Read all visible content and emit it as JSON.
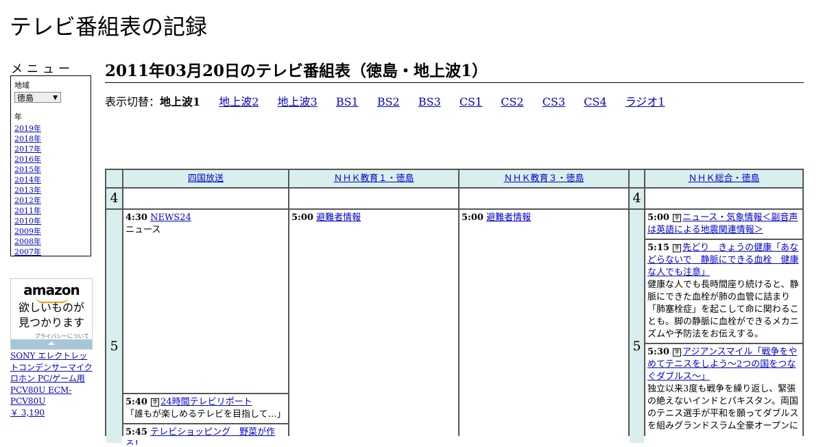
{
  "site": {
    "title": "テレビ番組表の記録"
  },
  "menu": {
    "label": "メニュー",
    "region_label": "地域",
    "region_value": "徳島",
    "year_label": "年",
    "years": [
      "2019年",
      "2018年",
      "2017年",
      "2016年",
      "2015年",
      "2014年",
      "2013年",
      "2012年",
      "2011年",
      "2010年",
      "2009年",
      "2008年",
      "2007年"
    ]
  },
  "ad": {
    "logo": "amazon",
    "line1": "欲しいものが",
    "line2": "見つかります",
    "privacy": "プライバシーについて",
    "product_name": "SONY エレクトレットコンデンサーマイクロホン PC/ゲーム用 PCV80U ECM-PCV80U",
    "product_price": "￥ 3,190"
  },
  "page": {
    "heading": "2011年03月20日のテレビ番組表（徳島・地上波1）",
    "switch_label": "表示切替：",
    "switch_current": "地上波1",
    "switch_links": [
      "地上波2",
      "地上波3",
      "BS1",
      "BS2",
      "BS3",
      "CS1",
      "CS2",
      "CS3",
      "CS4",
      "ラジオ1"
    ]
  },
  "schedule": {
    "channels": [
      "四国放送",
      "ＮＨＫ教育１・徳島",
      "ＮＨＫ教育３・徳島",
      "ＮＨＫ総合・徳島"
    ],
    "hours": [
      "4",
      "5"
    ],
    "col1": [
      {
        "time": "4:30",
        "title": "NEWS24",
        "desc": "ニュース"
      },
      {
        "time": "5:40",
        "title": "24時間テレビリポート",
        "desc": "「誰もが楽しめるテレビを目指して…」"
      },
      {
        "time": "5:45",
        "title": "テレビショッピング　野菜が作る！",
        "desc": ""
      }
    ],
    "col2": [
      {
        "time": "5:00",
        "title": "避難者情報"
      }
    ],
    "col3": [
      {
        "time": "5:00",
        "title": "避難者情報"
      }
    ],
    "col4": [
      {
        "time": "5:00",
        "title": "ニュース・気象情報＜副音声は英語による地震関連情報＞",
        "desc": ""
      },
      {
        "time": "5:15",
        "title": "先どり　きょうの健康「あなどらないで　静脈にできる血栓　健康な人でも注意」",
        "desc": "健康な人でも長時間座り続けると、静脈にできた血栓が肺の血管に詰まり「肺塞栓症」を起こして命に関わることも。脚の静脈に血栓ができるメカニズムや予防法をお伝えする。"
      },
      {
        "time": "5:30",
        "title": "アジアンスマイル「戦争をやめてテニスをしよう～2つの国をつなぐダブルス～」",
        "desc": "独立以来3度も戦争を繰り返し、緊張の絶えないインドとパキスタン。両国のテニス選手が平和を願ってダブルスを組みグランドスラム全豪オープンに"
      }
    ]
  }
}
